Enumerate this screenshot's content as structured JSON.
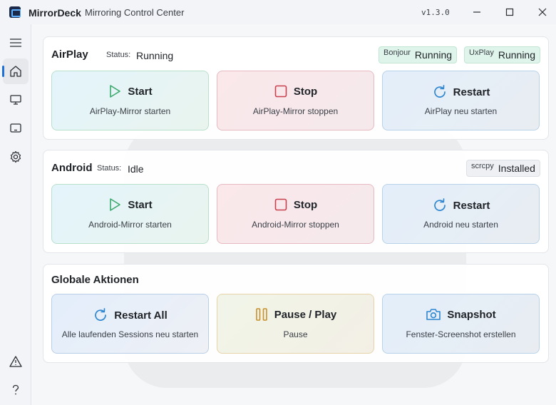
{
  "app": {
    "name": "MirrorDeck",
    "subtitle": "Mirroring Control Center",
    "version": "v1.3.0"
  },
  "sidebar": {
    "items": [
      {
        "icon": "menu-icon",
        "active": false
      },
      {
        "icon": "home-icon",
        "active": true
      },
      {
        "icon": "monitor-icon",
        "active": false
      },
      {
        "icon": "tablet-icon",
        "active": false
      },
      {
        "icon": "gear-icon",
        "active": false
      },
      {
        "icon": "warning-icon",
        "active": false
      },
      {
        "icon": "help-icon",
        "active": false
      }
    ]
  },
  "airplay": {
    "title": "AirPlay",
    "status_label": "Status:",
    "status_value": "Running",
    "badges": [
      {
        "name": "Bonjour",
        "value": "Running"
      },
      {
        "name": "UxPlay",
        "value": "Running"
      }
    ],
    "actions": [
      {
        "label": "Start",
        "sub": "AirPlay-Mirror starten",
        "icon": "play-icon"
      },
      {
        "label": "Stop",
        "sub": "AirPlay-Mirror stoppen",
        "icon": "stop-icon"
      },
      {
        "label": "Restart",
        "sub": "AirPlay neu starten",
        "icon": "restart-icon"
      }
    ]
  },
  "android": {
    "title": "Android",
    "status_label": "Status:",
    "status_value": "Idle",
    "badges": [
      {
        "name": "scrcpy",
        "value": "Installed"
      }
    ],
    "actions": [
      {
        "label": "Start",
        "sub": "Android-Mirror starten",
        "icon": "play-icon"
      },
      {
        "label": "Stop",
        "sub": "Android-Mirror stoppen",
        "icon": "stop-icon"
      },
      {
        "label": "Restart",
        "sub": "Android neu starten",
        "icon": "restart-icon"
      }
    ]
  },
  "global": {
    "title": "Globale Aktionen",
    "actions": [
      {
        "label": "Restart All",
        "sub": "Alle laufenden Sessions neu starten",
        "icon": "restart-icon"
      },
      {
        "label": "Pause / Play",
        "sub": "Pause",
        "icon": "pause-icon"
      },
      {
        "label": "Snapshot",
        "sub": "Fenster-Screenshot erstellen",
        "icon": "camera-icon"
      }
    ]
  },
  "colors": {
    "accent": "#1f6fd6",
    "play": "#3aa86b",
    "stop": "#c8414f",
    "restart": "#2f86d0",
    "pause": "#c8902a"
  }
}
